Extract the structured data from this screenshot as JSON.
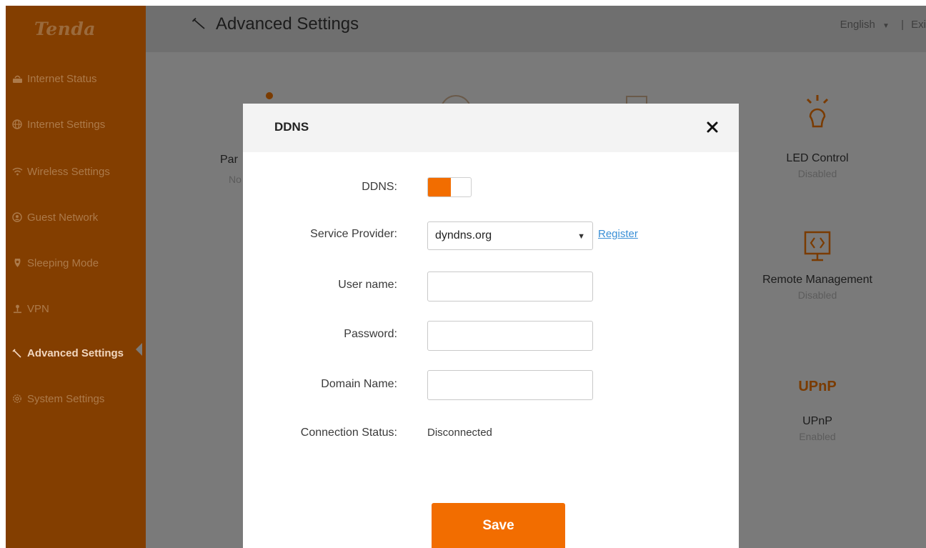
{
  "brand": {
    "logo_text": "Tenda"
  },
  "sidebar": {
    "items": [
      {
        "label": "Internet Status",
        "icon": "router-icon"
      },
      {
        "label": "Internet Settings",
        "icon": "globe-icon"
      },
      {
        "label": "Wireless Settings",
        "icon": "wifi-icon"
      },
      {
        "label": "Guest Network",
        "icon": "guest-network-icon"
      },
      {
        "label": "Sleeping Mode",
        "icon": "moon-icon"
      },
      {
        "label": "VPN",
        "icon": "vpn-icon"
      },
      {
        "label": "Advanced Settings",
        "icon": "wrench-icon",
        "active": true
      },
      {
        "label": "System Settings",
        "icon": "gear-icon"
      }
    ]
  },
  "header": {
    "title": "Advanced Settings",
    "language": "English",
    "separator": "|",
    "exit_label": "Exi"
  },
  "background_tiles": {
    "partial_left_name": "Par",
    "partial_left_status": "No",
    "led": {
      "name": "LED Control",
      "status": "Disabled"
    },
    "remote": {
      "name": "Remote Management",
      "status": "Disabled"
    },
    "upnp": {
      "name": "UPnP",
      "status": "Enabled",
      "icon_text": "UPnP"
    }
  },
  "modal": {
    "title": "DDNS",
    "close_icon": "close-icon",
    "labels": {
      "ddns": "DDNS:",
      "service_provider": "Service Provider:",
      "user_name": "User name:",
      "password": "Password:",
      "domain_name": "Domain Name:",
      "connection_status": "Connection Status:"
    },
    "ddns_enabled": true,
    "service_provider_value": "dyndns.org",
    "register_label": "Register",
    "user_name_value": "",
    "password_value": "",
    "domain_name_value": "",
    "connection_status_value": "Disconnected",
    "save_label": "Save"
  },
  "colors": {
    "accent": "#f26d00",
    "sidebar_bg": "#833e00",
    "overlay_bg": "#7a7a7a",
    "link": "#3a8fd6"
  }
}
